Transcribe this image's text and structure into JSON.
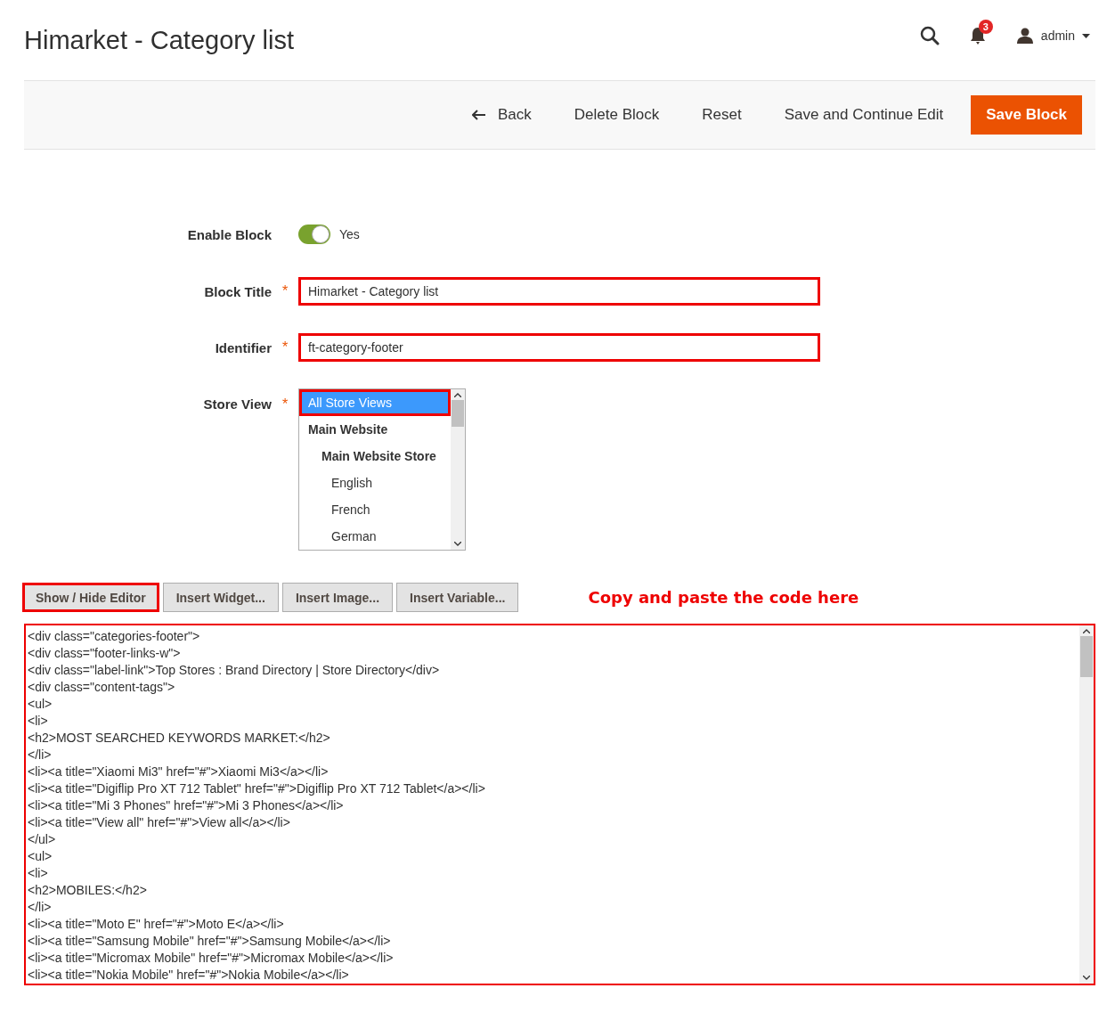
{
  "page_title": "Himarket - Category list",
  "header": {
    "notification_count": "3",
    "user": "admin"
  },
  "actions": [
    {
      "label": "Back",
      "kind": "back"
    },
    {
      "label": "Delete Block",
      "kind": "plain"
    },
    {
      "label": "Reset",
      "kind": "plain"
    },
    {
      "label": "Save and Continue Edit",
      "kind": "plain"
    },
    {
      "label": "Save Block",
      "kind": "primary"
    }
  ],
  "form": {
    "enable_block": {
      "label": "Enable Block",
      "on": true,
      "value_label": "Yes"
    },
    "block_title": {
      "label": "Block Title",
      "required_mark": "*",
      "value": "Himarket - Category list",
      "highlighted": true
    },
    "identifier": {
      "label": "Identifier",
      "required_mark": "*",
      "value": "ft-category-footer",
      "highlighted": true
    },
    "store_view": {
      "label": "Store View",
      "required_mark": "*",
      "options": [
        {
          "label": "All Store Views",
          "kind": "view",
          "selected": true,
          "highlighted": true
        },
        {
          "label": "Main Website",
          "kind": "website",
          "selected": false,
          "highlighted": false
        },
        {
          "label": "Main Website Store",
          "kind": "store",
          "selected": false,
          "highlighted": false
        },
        {
          "label": "English",
          "kind": "view",
          "selected": false,
          "highlighted": false
        },
        {
          "label": "French",
          "kind": "view",
          "selected": false,
          "highlighted": false
        },
        {
          "label": "German",
          "kind": "view",
          "selected": false,
          "highlighted": false
        }
      ]
    }
  },
  "editor_buttons": [
    {
      "label": "Show / Hide Editor",
      "highlighted": true
    },
    {
      "label": "Insert Widget...",
      "highlighted": false
    },
    {
      "label": "Insert Image...",
      "highlighted": false
    },
    {
      "label": "Insert Variable...",
      "highlighted": false
    }
  ],
  "annotation": "Copy and paste the code here",
  "editor": {
    "highlighted": true,
    "lines": [
      "<div class=\"categories-footer\">",
      "<div class=\"footer-links-w\">",
      "<div class=\"label-link\">Top Stores : Brand Directory | Store Directory</div>",
      "<div class=\"content-tags\">",
      "<ul>",
      "<li>",
      "<h2>MOST SEARCHED KEYWORDS MARKET:</h2>",
      "</li>",
      "<li><a title=\"Xiaomi Mi3\" href=\"#\">Xiaomi Mi3</a></li>",
      "<li><a title=\"Digiflip Pro XT 712 Tablet\" href=\"#\">Digiflip Pro XT 712 Tablet</a></li>",
      "<li><a title=\"Mi 3 Phones\" href=\"#\">Mi 3 Phones</a></li>",
      "<li><a title=\"View all\" href=\"#\">View all</a></li>",
      "</ul>",
      "<ul>",
      "<li>",
      "<h2>MOBILES:</h2>",
      "</li>",
      "<li><a title=\"Moto E\" href=\"#\">Moto E</a></li>",
      "<li><a title=\"Samsung Mobile\" href=\"#\">Samsung Mobile</a></li>",
      "<li><a title=\"Micromax Mobile\" href=\"#\">Micromax Mobile</a></li>",
      "<li><a title=\"Nokia Mobile\" href=\"#\">Nokia Mobile</a></li>"
    ]
  }
}
